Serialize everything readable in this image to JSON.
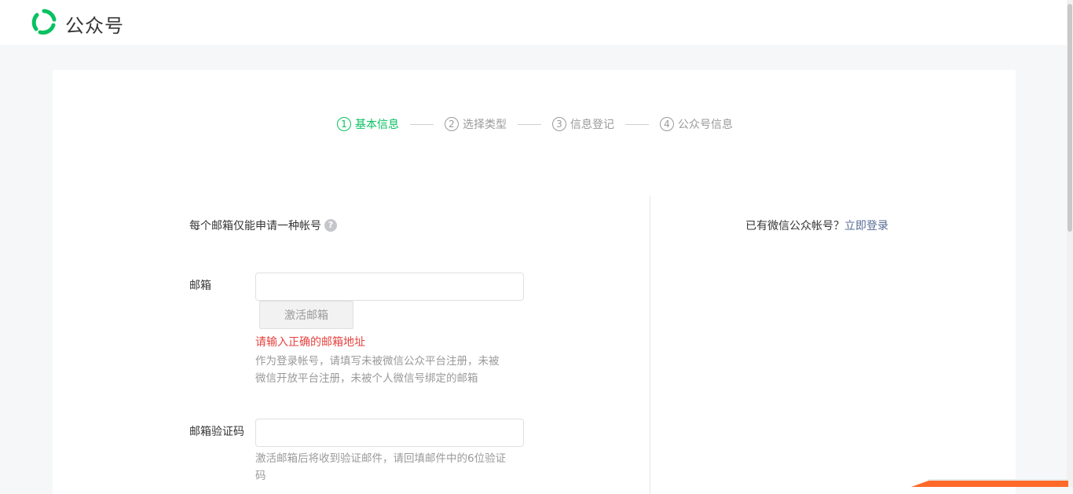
{
  "header": {
    "brand": "公众号",
    "logo_icon": "wechat-official-account-logo"
  },
  "steps": [
    {
      "num": "1",
      "label": "基本信息",
      "active": true
    },
    {
      "num": "2",
      "label": "选择类型",
      "active": false
    },
    {
      "num": "3",
      "label": "信息登记",
      "active": false
    },
    {
      "num": "4",
      "label": "公众号信息",
      "active": false
    }
  ],
  "form": {
    "intro": "每个邮箱仅能申请一种帐号",
    "email": {
      "label": "邮箱",
      "value": "",
      "placeholder": ""
    },
    "activate_button": "激活邮箱",
    "error": "请输入正确的邮箱地址",
    "email_tip": "作为登录帐号，请填写未被微信公众平台注册，未被微信开放平台注册，未被个人微信号绑定的邮箱",
    "code": {
      "label": "邮箱验证码",
      "value": "",
      "placeholder": ""
    },
    "code_tip": "激活邮箱后将收到验证邮件，请回填邮件中的6位验证码"
  },
  "side": {
    "prompt": "已有微信公众帐号？",
    "login_link": "立即登录"
  },
  "colors": {
    "accent": "#07c160",
    "link": "#576b95",
    "error": "#e64340",
    "muted": "#9a9a9a"
  }
}
